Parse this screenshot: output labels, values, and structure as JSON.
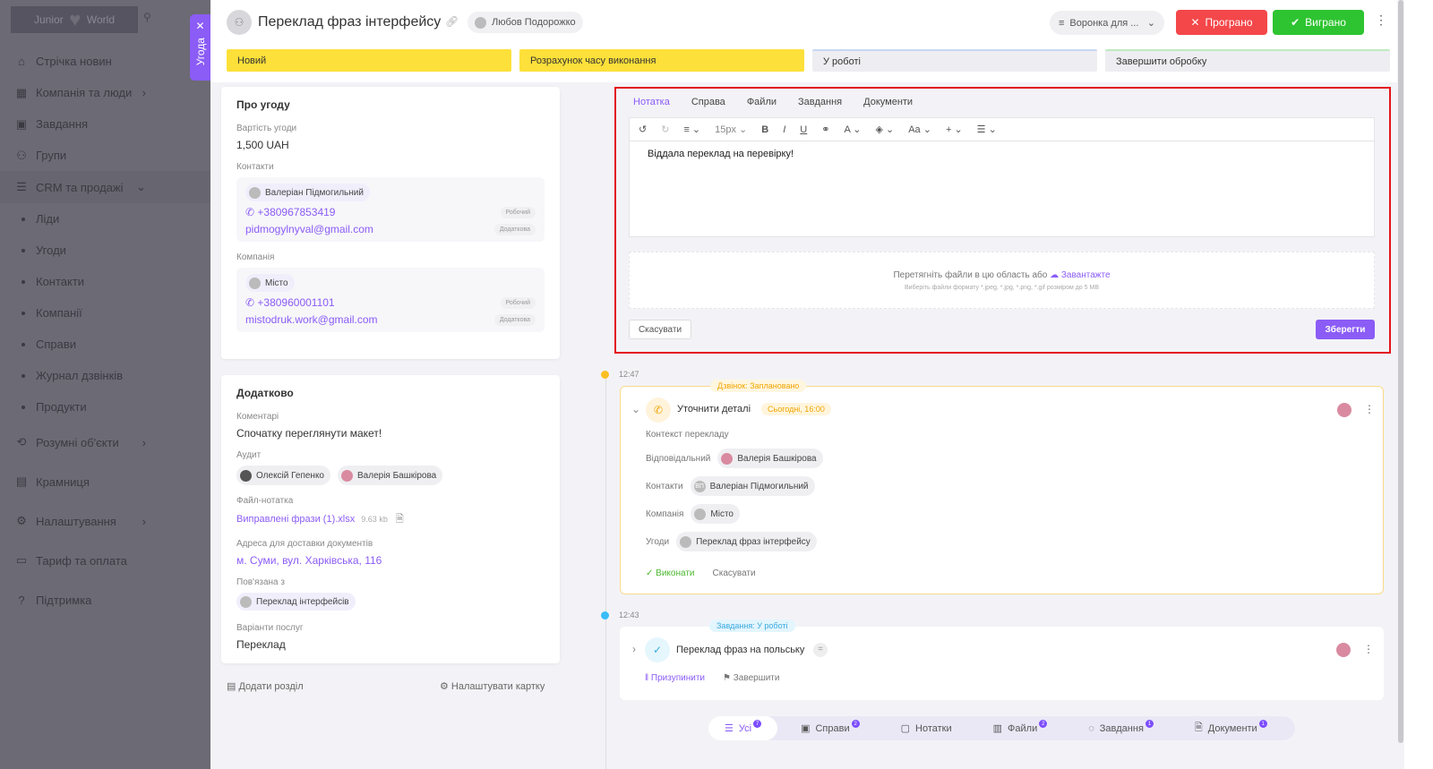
{
  "sidebar": {
    "logo": {
      "left": "Junior",
      "right": "World"
    },
    "items": [
      {
        "label": "Стрічка новин",
        "icon": "home-icon"
      },
      {
        "label": "Компанія та люди",
        "icon": "building-icon",
        "chevron": "›"
      },
      {
        "label": "Завдання",
        "icon": "calendar-icon"
      },
      {
        "label": "Групи",
        "icon": "users-icon"
      },
      {
        "label": "CRM та продажі",
        "icon": "stack-icon",
        "chevron": "⌄"
      },
      {
        "label": "Ліди",
        "sub": true
      },
      {
        "label": "Угоди",
        "sub": true
      },
      {
        "label": "Контакти",
        "sub": true
      },
      {
        "label": "Компанії",
        "sub": true
      },
      {
        "label": "Справи",
        "sub": true
      },
      {
        "label": "Журнал дзвінків",
        "sub": true
      },
      {
        "label": "Продукти",
        "sub": true
      },
      {
        "label": "Розумні об'єкти",
        "icon": "smart-icon",
        "chevron": "›"
      },
      {
        "label": "Крамниця",
        "icon": "store-icon"
      },
      {
        "label": "Налаштування",
        "icon": "gear-icon",
        "chevron": "›"
      },
      {
        "label": "Тариф та оплата",
        "icon": "wallet-icon"
      },
      {
        "label": "Підтримка",
        "icon": "help-icon"
      }
    ]
  },
  "side_tag": "Угода",
  "header": {
    "title": "Переклад фраз інтерфейсу",
    "owner": "Любов Подорожко",
    "funnel": "Воронка для ...",
    "lost": "Програно",
    "won": "Виграно"
  },
  "stages": [
    {
      "label": "Новий",
      "color": "#fde03a"
    },
    {
      "label": "Розрахунок часу виконання",
      "color": "#fde03a"
    },
    {
      "label": "У роботі",
      "color": "#eeeef2"
    },
    {
      "label": "Завершити обробку",
      "color": "#eeeef2"
    }
  ],
  "about": {
    "title": "Про угоду",
    "price_label": "Вартість угоди",
    "price": "1,500 UAH",
    "contacts_label": "Контакти",
    "contact": {
      "name": "Валеріан Підмогильний",
      "phone": "+380967853419",
      "phone_type": "Робочий",
      "email": "pidmogylnyval@gmail.com",
      "email_type": "Додаткова"
    },
    "company_label": "Компанія",
    "company": {
      "name": "Місто",
      "phone": "+380960001101",
      "phone_type": "Робочий",
      "email": "mistodruk.work@gmail.com",
      "email_type": "Додаткова"
    }
  },
  "extra": {
    "title": "Додатково",
    "comments_label": "Коментарі",
    "comments": "Спочатку переглянути макет!",
    "audit_label": "Аудит",
    "audit": [
      "Олексій Гепенко",
      "Валерія Башкірова"
    ],
    "file_label": "Файл-нотатка",
    "file": "Виправлені фрази (1).xlsx",
    "file_size": "9.63 kb",
    "address_label": "Адреса для доставки документів",
    "address": "м. Суми, вул. Харківська, 116",
    "related_label": "Пов'язана з",
    "related": "Переклад інтерфейсів",
    "services_label": "Варіанти послуг",
    "services": "Переклад"
  },
  "footer_links": {
    "add_section": "Додати розділ",
    "configure": "Налаштувати картку"
  },
  "editor": {
    "tabs": [
      "Нотатка",
      "Справа",
      "Файли",
      "Завдання",
      "Документи"
    ],
    "font_size": "15px",
    "font_case": "Aa",
    "text": "Віддала переклад на перевірку!",
    "drop_text": "Перетягніть файли в цю область або",
    "upload": "Завантажте",
    "hint": "Виберіть файли формату *.jpeg, *.jpg, *.png, *.gif розміром до 5 MB",
    "cancel": "Скасувати",
    "save": "Зберегти"
  },
  "events": [
    {
      "time": "12:47",
      "badge": "Дзвінок: Заплановано",
      "title": "Уточнити деталі",
      "due": "Сьогодні, 16:00",
      "context": "Контекст перекладу",
      "responsible_label": "Відповідальний",
      "responsible": "Валерія Башкірова",
      "contacts_label": "Контакти",
      "contact": "Валеріан Підмогильний",
      "contact_initials": "ВП",
      "company_label": "Компанія",
      "company": "Місто",
      "deals_label": "Угоди",
      "deal": "Переклад фраз інтерфейсу",
      "done": "Виконати",
      "cancel": "Скасувати",
      "color": "#fbbf24"
    },
    {
      "time": "12:43",
      "badge": "Завдання: У роботі",
      "title": "Переклад фраз на польську",
      "pause": "Призупинити",
      "finish": "Завершити",
      "color": "#38bdf8"
    }
  ],
  "bottom_tabs": [
    {
      "label": "Усі",
      "count": "7"
    },
    {
      "label": "Справи",
      "count": "2"
    },
    {
      "label": "Нотатки",
      "count": ""
    },
    {
      "label": "Файли",
      "count": "2"
    },
    {
      "label": "Завдання",
      "count": "1"
    },
    {
      "label": "Документи",
      "count": "1"
    }
  ]
}
